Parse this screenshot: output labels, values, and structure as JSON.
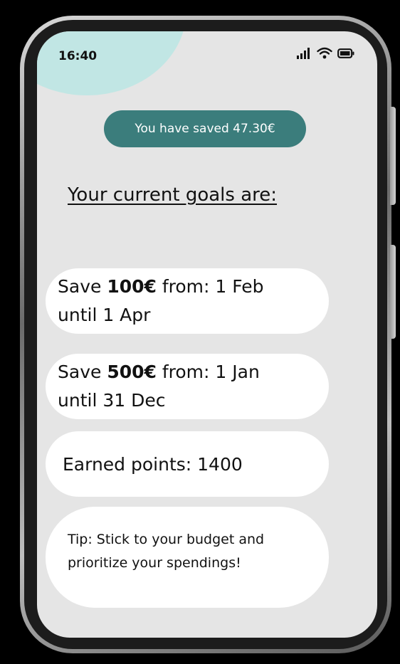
{
  "status_bar": {
    "time": "16:40",
    "icons": [
      "signal-icon",
      "wifi-icon",
      "battery-icon"
    ]
  },
  "savings": {
    "label": "You have saved 47.30€"
  },
  "goals_heading": "Your current goals are:",
  "goals": [
    {
      "prefix": "Save ",
      "amount": "100€",
      "middle": " from:  1 Feb",
      "line2": "until 1 Apr"
    },
    {
      "prefix": "Save ",
      "amount": "500€",
      "middle": " from:  1 Jan",
      "line2": "until 31 Dec"
    }
  ],
  "points": {
    "label": "Earned points: 1400"
  },
  "tip": {
    "line1": "Tip: Stick to your budget and",
    "line2": "prioritize your spendings!"
  },
  "colors": {
    "accent_teal": "#3b7d7c",
    "blob_teal": "#c1e6e4",
    "screen_bg": "#e5e5e5",
    "card_bg": "#ffffff"
  }
}
